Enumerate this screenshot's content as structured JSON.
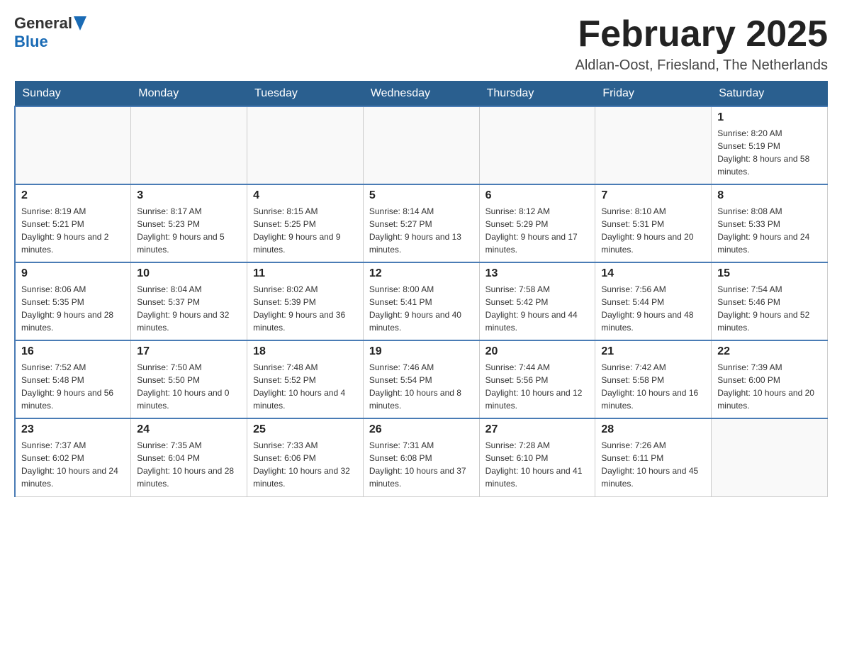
{
  "header": {
    "logo": {
      "text_general": "General",
      "text_blue": "Blue"
    },
    "title": "February 2025",
    "location": "Aldlan-Oost, Friesland, The Netherlands"
  },
  "days_of_week": [
    "Sunday",
    "Monday",
    "Tuesday",
    "Wednesday",
    "Thursday",
    "Friday",
    "Saturday"
  ],
  "weeks": [
    {
      "days": [
        {
          "number": "",
          "info": ""
        },
        {
          "number": "",
          "info": ""
        },
        {
          "number": "",
          "info": ""
        },
        {
          "number": "",
          "info": ""
        },
        {
          "number": "",
          "info": ""
        },
        {
          "number": "",
          "info": ""
        },
        {
          "number": "1",
          "info": "Sunrise: 8:20 AM\nSunset: 5:19 PM\nDaylight: 8 hours and 58 minutes."
        }
      ]
    },
    {
      "days": [
        {
          "number": "2",
          "info": "Sunrise: 8:19 AM\nSunset: 5:21 PM\nDaylight: 9 hours and 2 minutes."
        },
        {
          "number": "3",
          "info": "Sunrise: 8:17 AM\nSunset: 5:23 PM\nDaylight: 9 hours and 5 minutes."
        },
        {
          "number": "4",
          "info": "Sunrise: 8:15 AM\nSunset: 5:25 PM\nDaylight: 9 hours and 9 minutes."
        },
        {
          "number": "5",
          "info": "Sunrise: 8:14 AM\nSunset: 5:27 PM\nDaylight: 9 hours and 13 minutes."
        },
        {
          "number": "6",
          "info": "Sunrise: 8:12 AM\nSunset: 5:29 PM\nDaylight: 9 hours and 17 minutes."
        },
        {
          "number": "7",
          "info": "Sunrise: 8:10 AM\nSunset: 5:31 PM\nDaylight: 9 hours and 20 minutes."
        },
        {
          "number": "8",
          "info": "Sunrise: 8:08 AM\nSunset: 5:33 PM\nDaylight: 9 hours and 24 minutes."
        }
      ]
    },
    {
      "days": [
        {
          "number": "9",
          "info": "Sunrise: 8:06 AM\nSunset: 5:35 PM\nDaylight: 9 hours and 28 minutes."
        },
        {
          "number": "10",
          "info": "Sunrise: 8:04 AM\nSunset: 5:37 PM\nDaylight: 9 hours and 32 minutes."
        },
        {
          "number": "11",
          "info": "Sunrise: 8:02 AM\nSunset: 5:39 PM\nDaylight: 9 hours and 36 minutes."
        },
        {
          "number": "12",
          "info": "Sunrise: 8:00 AM\nSunset: 5:41 PM\nDaylight: 9 hours and 40 minutes."
        },
        {
          "number": "13",
          "info": "Sunrise: 7:58 AM\nSunset: 5:42 PM\nDaylight: 9 hours and 44 minutes."
        },
        {
          "number": "14",
          "info": "Sunrise: 7:56 AM\nSunset: 5:44 PM\nDaylight: 9 hours and 48 minutes."
        },
        {
          "number": "15",
          "info": "Sunrise: 7:54 AM\nSunset: 5:46 PM\nDaylight: 9 hours and 52 minutes."
        }
      ]
    },
    {
      "days": [
        {
          "number": "16",
          "info": "Sunrise: 7:52 AM\nSunset: 5:48 PM\nDaylight: 9 hours and 56 minutes."
        },
        {
          "number": "17",
          "info": "Sunrise: 7:50 AM\nSunset: 5:50 PM\nDaylight: 10 hours and 0 minutes."
        },
        {
          "number": "18",
          "info": "Sunrise: 7:48 AM\nSunset: 5:52 PM\nDaylight: 10 hours and 4 minutes."
        },
        {
          "number": "19",
          "info": "Sunrise: 7:46 AM\nSunset: 5:54 PM\nDaylight: 10 hours and 8 minutes."
        },
        {
          "number": "20",
          "info": "Sunrise: 7:44 AM\nSunset: 5:56 PM\nDaylight: 10 hours and 12 minutes."
        },
        {
          "number": "21",
          "info": "Sunrise: 7:42 AM\nSunset: 5:58 PM\nDaylight: 10 hours and 16 minutes."
        },
        {
          "number": "22",
          "info": "Sunrise: 7:39 AM\nSunset: 6:00 PM\nDaylight: 10 hours and 20 minutes."
        }
      ]
    },
    {
      "days": [
        {
          "number": "23",
          "info": "Sunrise: 7:37 AM\nSunset: 6:02 PM\nDaylight: 10 hours and 24 minutes."
        },
        {
          "number": "24",
          "info": "Sunrise: 7:35 AM\nSunset: 6:04 PM\nDaylight: 10 hours and 28 minutes."
        },
        {
          "number": "25",
          "info": "Sunrise: 7:33 AM\nSunset: 6:06 PM\nDaylight: 10 hours and 32 minutes."
        },
        {
          "number": "26",
          "info": "Sunrise: 7:31 AM\nSunset: 6:08 PM\nDaylight: 10 hours and 37 minutes."
        },
        {
          "number": "27",
          "info": "Sunrise: 7:28 AM\nSunset: 6:10 PM\nDaylight: 10 hours and 41 minutes."
        },
        {
          "number": "28",
          "info": "Sunrise: 7:26 AM\nSunset: 6:11 PM\nDaylight: 10 hours and 45 minutes."
        },
        {
          "number": "",
          "info": ""
        }
      ]
    }
  ],
  "colors": {
    "header_bg": "#2a5f8f",
    "header_text": "#ffffff",
    "border_top": "#4a7cb5"
  }
}
